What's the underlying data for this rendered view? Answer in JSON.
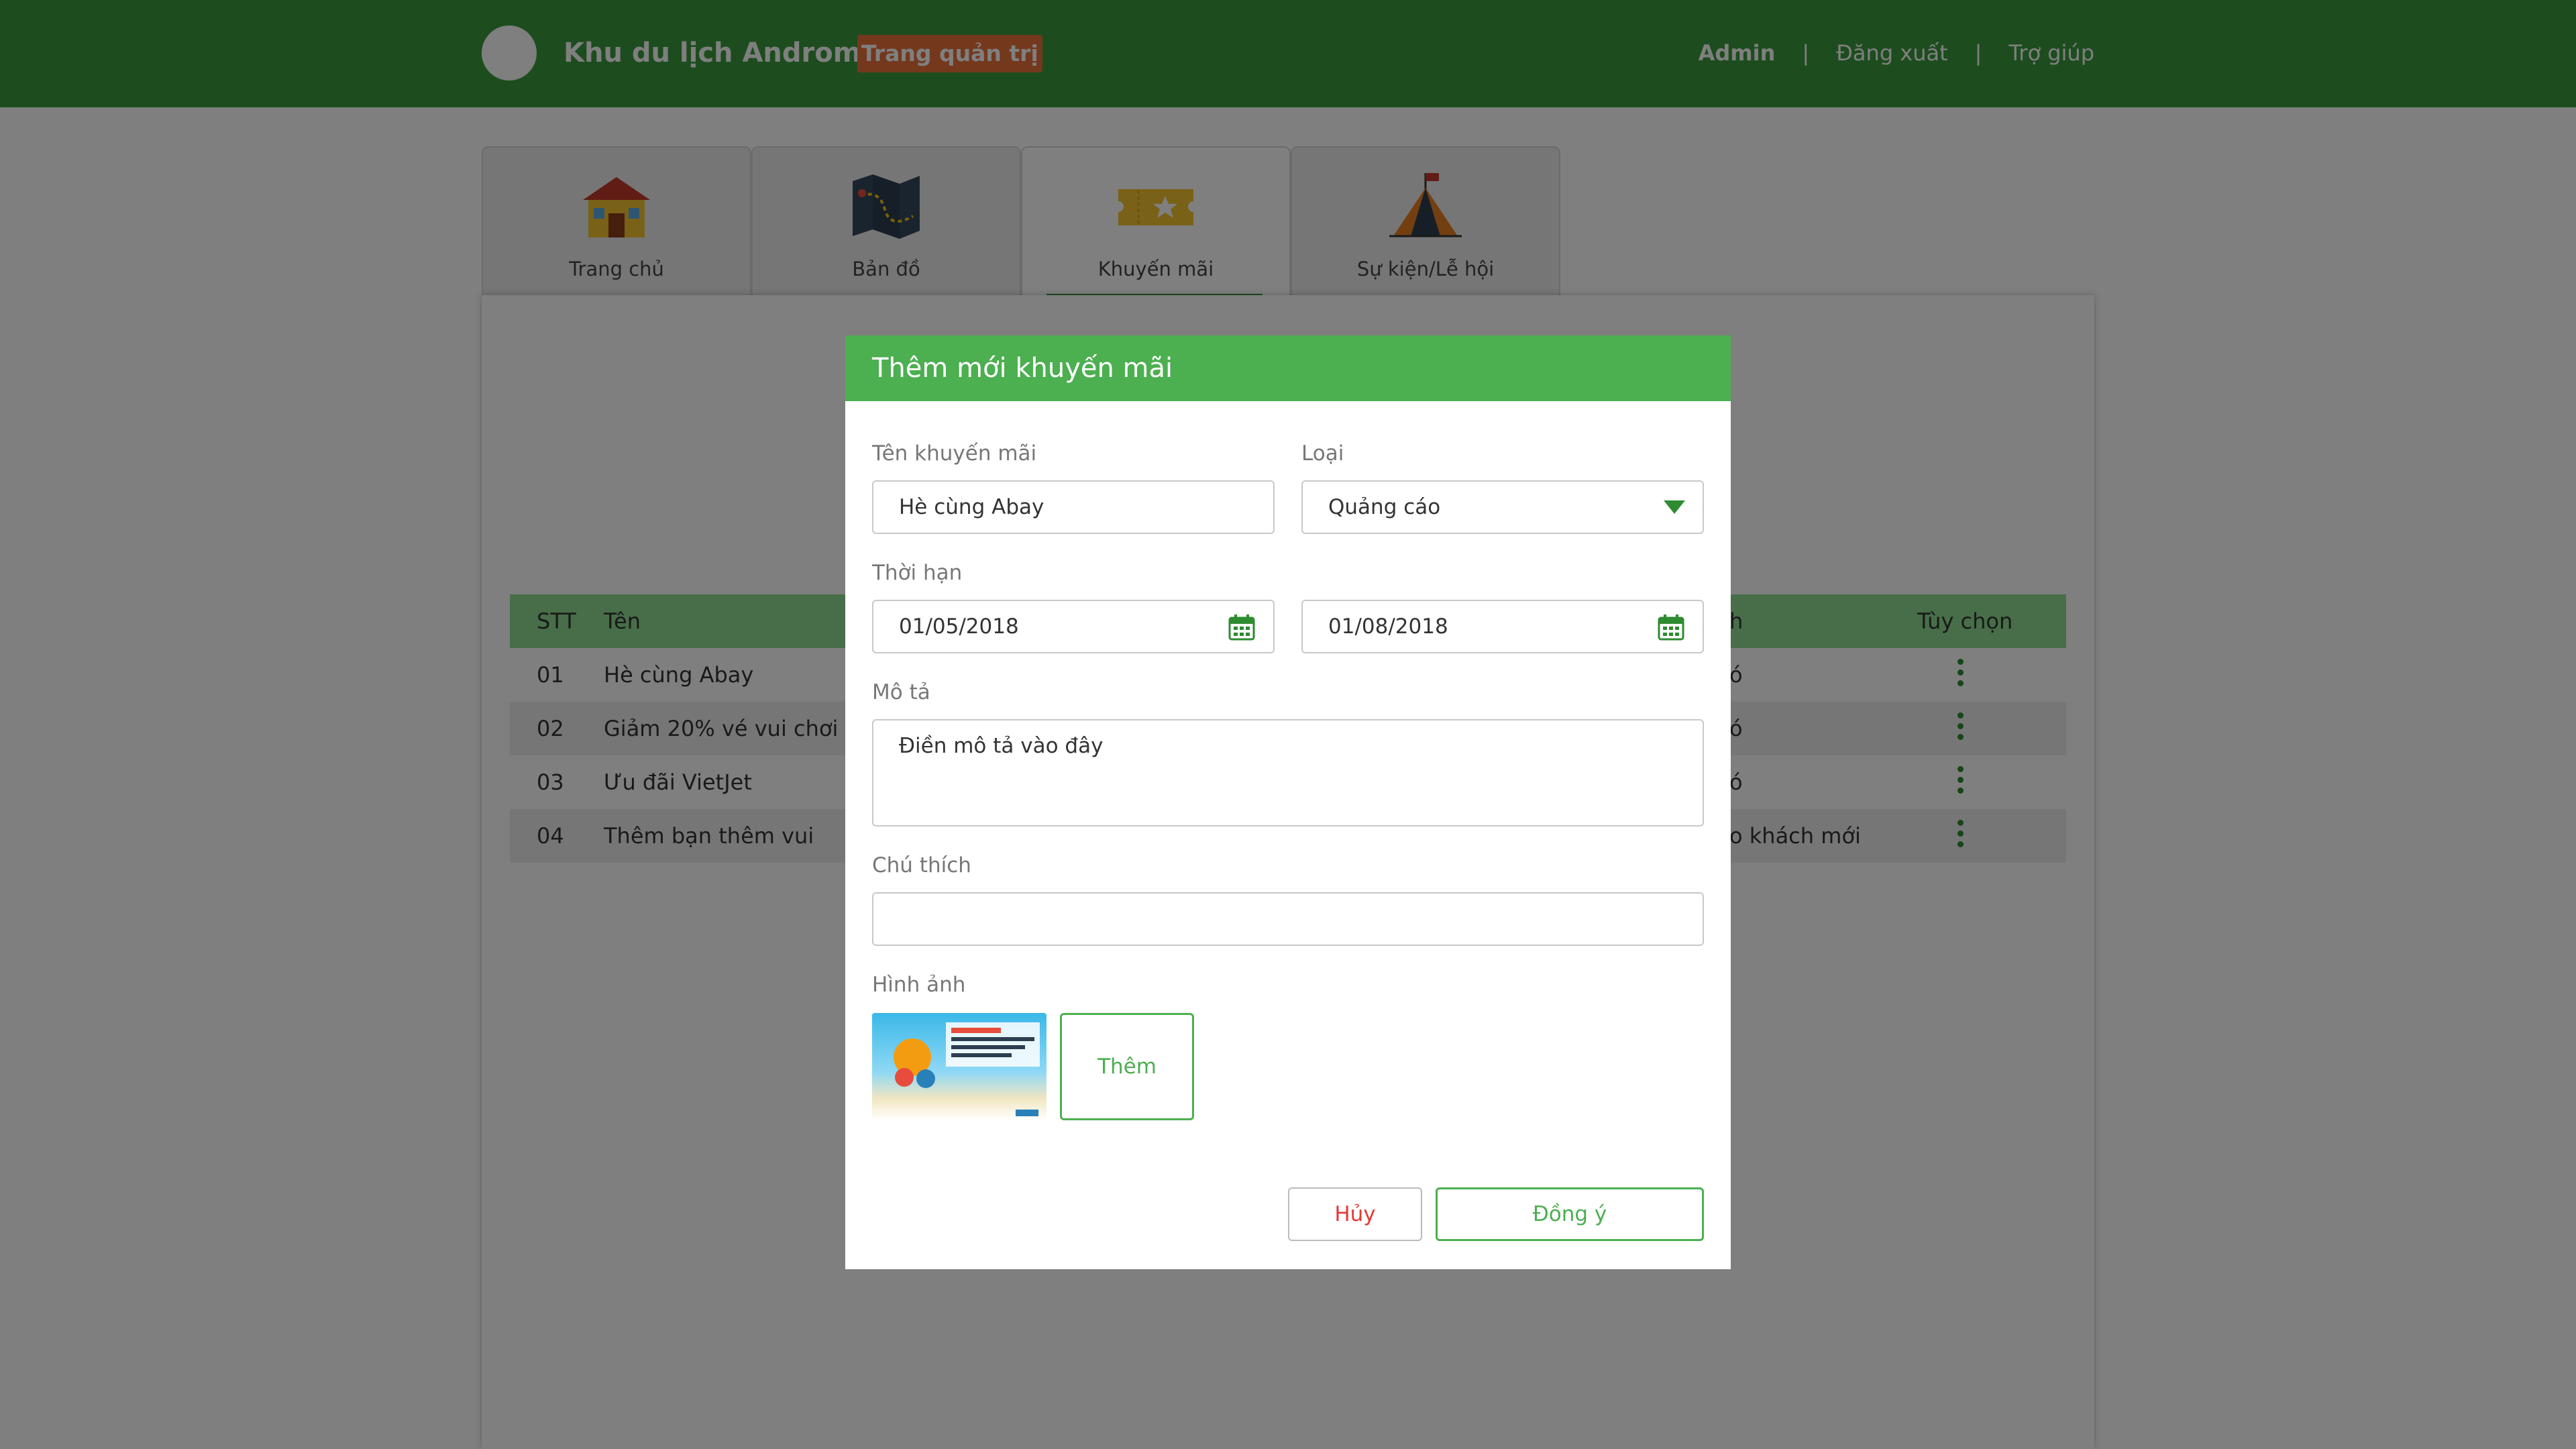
{
  "header": {
    "title": "Khu du lịch Andromeda",
    "badge": "Trang quản trị",
    "nav": {
      "admin": "Admin",
      "sep": "|",
      "logout": "Đăng xuất",
      "help": "Trợ giúp"
    }
  },
  "tabs": [
    {
      "label": "Trang chủ",
      "icon": "house-icon"
    },
    {
      "label": "Bản đồ",
      "icon": "map-icon"
    },
    {
      "label": "Khuyến mãi",
      "icon": "ticket-icon"
    },
    {
      "label": "Sự kiện/Lễ hội",
      "icon": "tent-icon"
    }
  ],
  "table": {
    "headers": {
      "stt": "STT",
      "name": "Tên",
      "hidden": "h",
      "options": "Tùy chọn"
    },
    "rows": [
      {
        "stt": "01",
        "name": "Hè cùng Abay",
        "tail": "ó"
      },
      {
        "stt": "02",
        "name": "Giảm 20% vé vui chơi",
        "tail": "ó"
      },
      {
        "stt": "03",
        "name": "Ưu đãi VietJet",
        "tail": "ó"
      },
      {
        "stt": "04",
        "name": "Thêm bạn thêm vui",
        "tail": "o khách mới"
      }
    ]
  },
  "modal": {
    "title": "Thêm mới khuyến mãi",
    "name_label": "Tên khuyến mãi",
    "name_value": "Hè cùng Abay",
    "type_label": "Loại",
    "type_value": "Quảng cáo",
    "period_label": "Thời hạn",
    "start_date": "01/05/2018",
    "end_date": "01/08/2018",
    "desc_label": "Mô tả",
    "desc_value": "Điền mô tả vào đây",
    "note_label": "Chú thích",
    "note_value": "",
    "image_label": "Hình ảnh",
    "add_label": "Thêm",
    "cancel_label": "Hủy",
    "ok_label": "Đồng ý"
  },
  "colors": {
    "header": "#3a9a3c",
    "accent": "#4caf50",
    "badge": "#e8703a",
    "cancel": "#e53935"
  }
}
